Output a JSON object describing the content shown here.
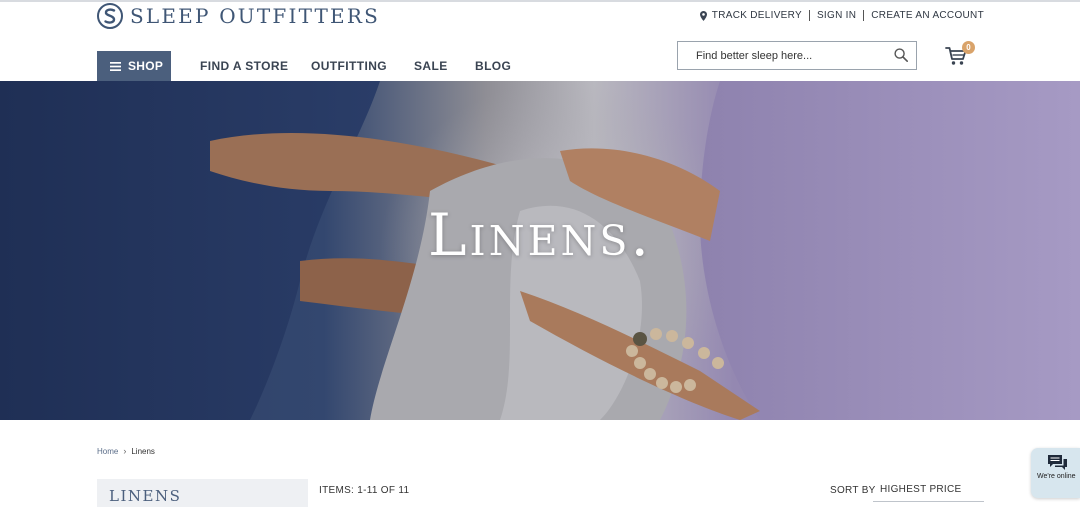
{
  "header": {
    "logo_text": "SLEEP OUTFITTERS",
    "utility_links": {
      "track_delivery": "TRACK DELIVERY",
      "sign_in": "SIGN IN",
      "create_account": "CREATE AN ACCOUNT"
    }
  },
  "nav": {
    "shop_label": "SHOP",
    "items": [
      "FIND A STORE",
      "OUTFITTING",
      "SALE",
      "BLOG"
    ]
  },
  "search": {
    "placeholder": "Find better sleep here...",
    "value": ""
  },
  "cart": {
    "count": "0"
  },
  "hero": {
    "title": "Linens."
  },
  "breadcrumb": {
    "home": "Home",
    "current": "Linens"
  },
  "category": {
    "title": "LINENS",
    "items_count": "ITEMS: 1-11 OF 11",
    "sort_label": "SORT BY",
    "sort_value": "HIGHEST PRICE"
  },
  "chat": {
    "label": "We're online"
  },
  "icons": {
    "logo": "sleep-outfitters-logo-mark",
    "pin": "map-pin-icon",
    "menu": "hamburger-menu-icon",
    "search": "magnifier-icon",
    "cart": "shopping-cart-icon",
    "chat": "chat-bubbles-icon",
    "breadcrumb_separator": "chevron-right-icon"
  },
  "colors": {
    "brand_navy": "#4b5f7d",
    "cart_badge": "#d9a36a",
    "chat_bg": "#d7e6ee"
  }
}
